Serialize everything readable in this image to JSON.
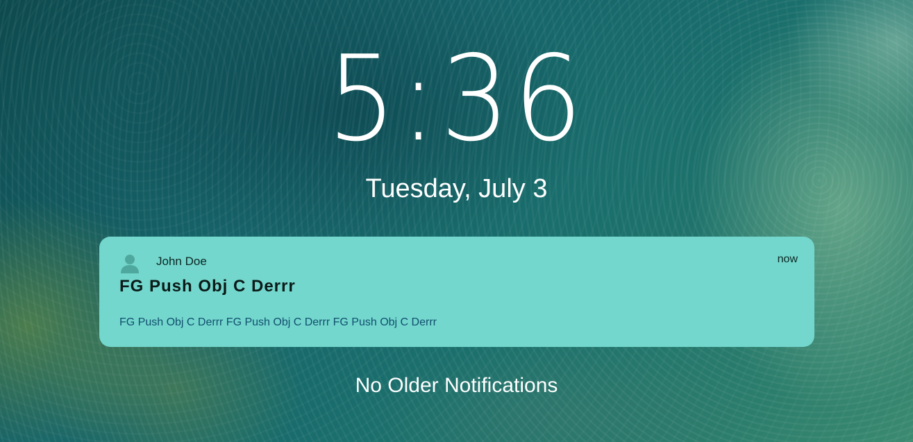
{
  "lockscreen": {
    "time": "5:36",
    "date": "Tuesday, July 3",
    "footer": "No Older Notifications"
  },
  "notification": {
    "avatar_icon": "person-icon",
    "sender": "John Doe",
    "timestamp": "now",
    "title": "FG Push Obj C Derrr",
    "body": "FG Push Obj C Derrr FG Push Obj C Derrr FG Push Obj C Derrr",
    "background_color": "#73d7cd"
  }
}
